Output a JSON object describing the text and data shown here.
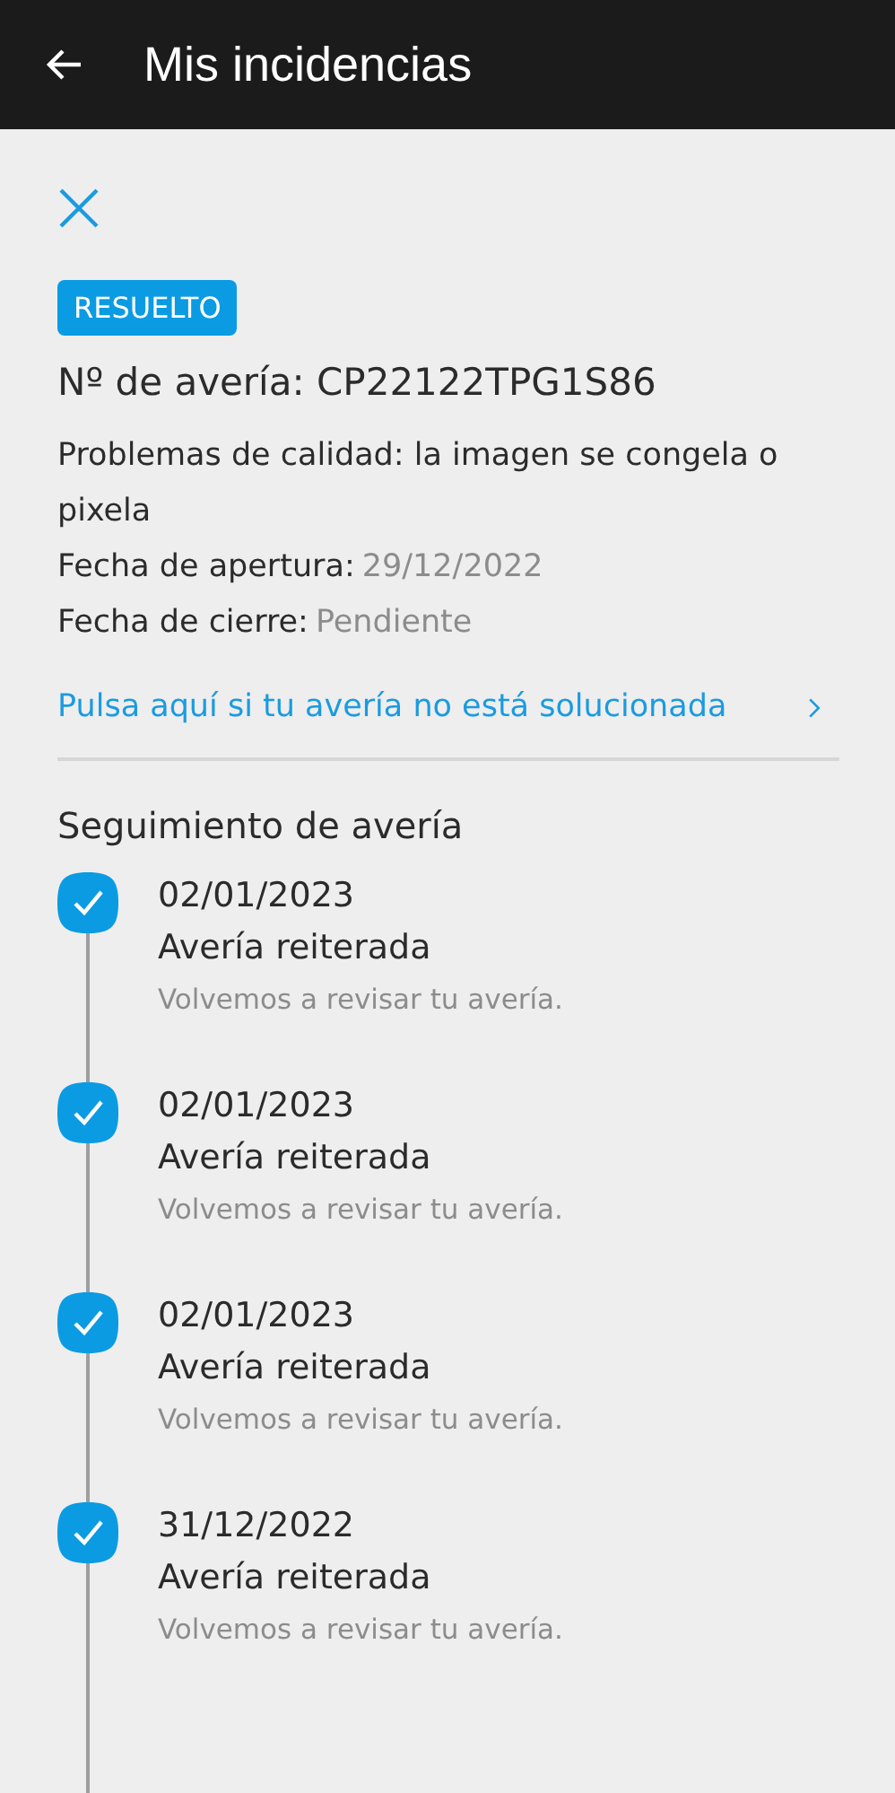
{
  "app_bar": {
    "title": "Mis incidencias"
  },
  "status_badge": "RESUELTO",
  "fault_number": "Nº de avería: CP22122TPG1S86",
  "details": [
    {
      "label": "Problemas de calidad: la imagen se congela o pixela"
    },
    {
      "label": "Fecha de apertura:",
      "value": "29/12/2022"
    },
    {
      "label": "Fecha de cierre:",
      "value": "Pendiente"
    }
  ],
  "help_link": "Pulsa aquí si tu avería no está solucionada",
  "tracking": {
    "title": "Seguimiento de avería",
    "steps": [
      {
        "date": "02/01/2023",
        "title": "Avería reiterada",
        "description": "Volvemos a revisar tu avería.",
        "done": true
      },
      {
        "date": "02/01/2023",
        "title": "Avería reiterada",
        "description": "Volvemos a revisar tu avería.",
        "done": true
      },
      {
        "date": "02/01/2023",
        "title": "Avería reiterada",
        "description": "Volvemos a revisar tu avería.",
        "done": true
      },
      {
        "date": "31/12/2022",
        "title": "Avería reiterada",
        "description": "Volvemos a revisar tu avería.",
        "done": true
      }
    ]
  }
}
